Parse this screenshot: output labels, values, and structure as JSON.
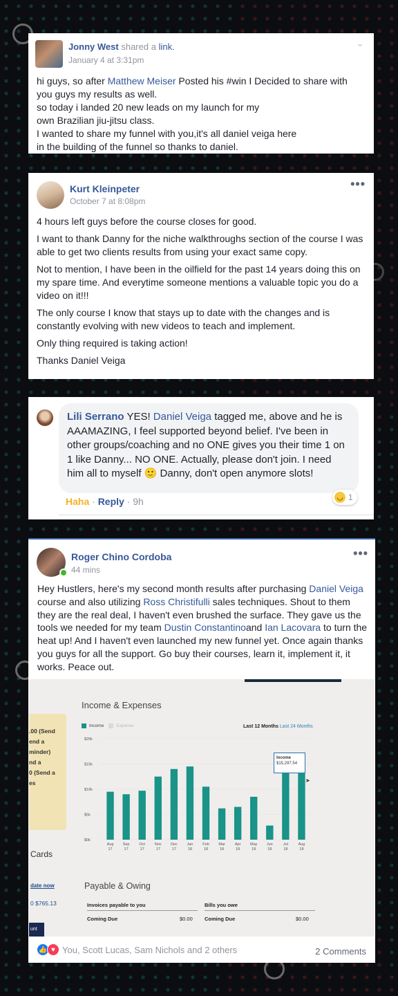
{
  "post1": {
    "author": "Jonny West",
    "action": "shared a",
    "action_link": "link.",
    "time": "January 4 at 3:31pm",
    "lines": [
      {
        "pre": "hi guys, so after ",
        "link": "Matthew Meiser",
        "post": " Posted his #win I Decided to share with"
      },
      {
        "pre": "you guys my results as well.",
        "link": "",
        "post": ""
      },
      {
        "pre": "so today i landed 20 new leads on my launch for my",
        "link": "",
        "post": ""
      },
      {
        "pre": "own Brazilian jiu-jitsu class.",
        "link": "",
        "post": ""
      },
      {
        "pre": "I wanted to share my funnel with you,it's all daniel veiga here",
        "link": "",
        "post": ""
      },
      {
        "pre": "in the building of the funnel so thanks to daniel.",
        "link": "",
        "post": ""
      }
    ]
  },
  "post2": {
    "author": "Kurt Kleinpeter",
    "time": "October 7 at 8:08pm",
    "menu": "•••",
    "paragraphs": [
      "4 hours left guys before the course closes for good.",
      "I want to thank Danny for the niche walkthroughs section of the course I was able to get two clients results from using your exact same copy.",
      "Not to mention, I have been in the oilfield for the past 14 years doing this on my spare time. And everytime someone mentions a valuable topic you do a video on it!!!",
      "The only course I know that stays up to date with the changes and is constantly evolving with new videos to teach and implement.",
      "Only thing required is taking action!",
      "Thanks Daniel Veiga"
    ]
  },
  "comment": {
    "author": "Lili Serrano",
    "pre": "YES! ",
    "mention": "Daniel Veiga",
    "text": " tagged me, above and he is AAAMAZING, I feel supported beyond belief. I've been in other groups/coaching and no ONE gives you their time 1 on 1 like Danny... NO ONE. Actually, please don't join. I need him all to myself ",
    "emoji": "🙂",
    "text2": " Danny, don't open anymore slots!",
    "reaction_label": "Haha",
    "reply_label": "Reply",
    "time": "9h",
    "reaction_count": "1"
  },
  "post3": {
    "author": "Roger Chino Cordoba",
    "time": "44 mins",
    "menu": "•••",
    "segments": [
      {
        "t": "Hey Hustlers, here's my second month results after purchasing ",
        "l": false
      },
      {
        "t": "Daniel Veiga",
        "l": true
      },
      {
        "t": " course and also utilizing ",
        "l": false
      },
      {
        "t": "Ross Christifulli",
        "l": true
      },
      {
        "t": " sales techniques. Shout to them they are the real deal, I haven't even brushed the surface. They gave us the tools we needed for my team ",
        "l": false
      },
      {
        "t": "Dustin Constantino",
        "l": true
      },
      {
        "t": "and ",
        "l": false
      },
      {
        "t": "Ian Lacovara",
        "l": true
      },
      {
        "t": " to turn the heat up! And I haven't even launched my new funnel yet. Once again thanks you guys for all the support. Go buy their courses, learn it, implement it, it works. Peace out.",
        "l": false
      }
    ],
    "reactions_text": "You, Scott Lucas, Sam Nichols and 2 others",
    "comments_text": "2 Comments"
  },
  "photo": {
    "panel_title": "Income & Expenses",
    "legend_income": "Income",
    "legend_expense": "Expense",
    "range_active": "Last 12 Months",
    "range_other": "Last 24 Months",
    "tooltip_title": "Income",
    "tooltip_value": "$15,297.54",
    "left_texts": [
      ".00 (Send",
      "end a",
      "minder)",
      "nd a",
      "0 (Send a",
      "es"
    ],
    "left_cards": "Cards",
    "left_update": "date now",
    "left_amount": "0 $765.13",
    "left_btn": "unt",
    "payable_title": "Payable & Owing",
    "inv_title": "Invoices payable to you",
    "bills_title": "Bills you owe",
    "coming_due": "Coming Due",
    "due_amount": "$0.00",
    "colors": {
      "bar": "#1a9389",
      "bg": "#f3f2f1"
    }
  },
  "chart_data": {
    "type": "bar",
    "title": "Income & Expenses",
    "categories": [
      "Aug 17",
      "Sep 17",
      "Oct 17",
      "Nov 17",
      "Dec 17",
      "Jan 18",
      "Feb 18",
      "Mar 18",
      "Apr 18",
      "May 18",
      "Jun 18",
      "Jul 18",
      "Aug 18"
    ],
    "cat_top": [
      "Aug",
      "Sep",
      "Oct",
      "Nov",
      "Dec",
      "Jan",
      "Feb",
      "Mar",
      "Apr",
      "May",
      "Jun",
      "Jul",
      "Aug"
    ],
    "cat_bottom": [
      "17",
      "17",
      "17",
      "17",
      "17",
      "18",
      "18",
      "18",
      "18",
      "18",
      "18",
      "18",
      "18"
    ],
    "series": [
      {
        "name": "Income",
        "values": [
          9500,
          9000,
          9700,
          12500,
          14000,
          14500,
          10500,
          6200,
          6500,
          8500,
          2800,
          15297.54,
          14900
        ]
      }
    ],
    "ytick_labels": [
      "$20k",
      "$15k",
      "$10k",
      "$5k",
      "$0k"
    ],
    "ytick_values": [
      20000,
      15000,
      10000,
      5000,
      0
    ],
    "ylim": [
      0,
      20000
    ]
  }
}
